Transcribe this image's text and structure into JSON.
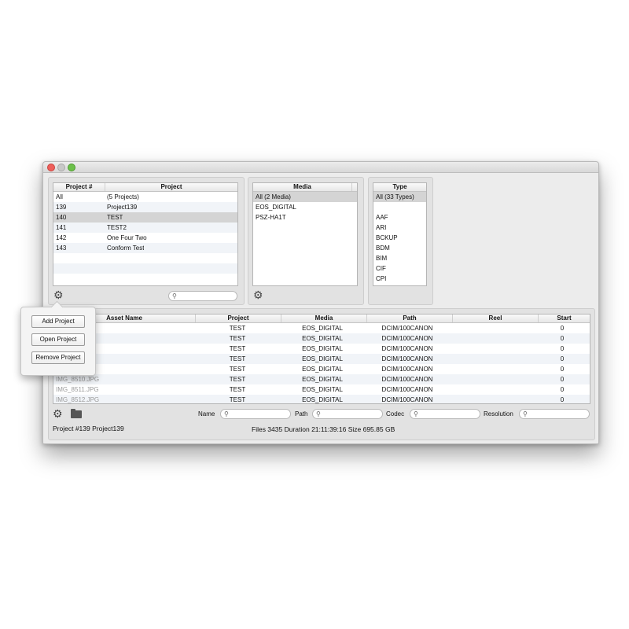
{
  "projects": {
    "headers": [
      "Project #",
      "Project"
    ],
    "rows": [
      [
        "All",
        "(5 Projects)"
      ],
      [
        "139",
        "Project139"
      ],
      [
        "140",
        "TEST"
      ],
      [
        "141",
        "TEST2"
      ],
      [
        "142",
        "One Four Two"
      ],
      [
        "143",
        "Conform Test"
      ]
    ]
  },
  "media": {
    "header": "Media",
    "rows": [
      "All (2 Media)",
      "EOS_DIGITAL",
      "PSZ-HA1T"
    ]
  },
  "type": {
    "header": "Type",
    "rows": [
      "All (33 Types)",
      "",
      "AAF",
      "ARI",
      "BCKUP",
      "BDM",
      "BIM",
      "CIF",
      "CPI"
    ]
  },
  "popover": {
    "add": "Add Project",
    "open": "Open Project",
    "remove": "Remove Project"
  },
  "assets": {
    "headers": [
      "Asset Name",
      "Project",
      "Media",
      "Path",
      "Reel",
      "Start"
    ],
    "rows": [
      [
        "",
        "TEST",
        "EOS_DIGITAL",
        "DCIM/100CANON",
        "",
        "0"
      ],
      [
        "",
        "TEST",
        "EOS_DIGITAL",
        "DCIM/100CANON",
        "",
        "0"
      ],
      [
        "",
        "TEST",
        "EOS_DIGITAL",
        "DCIM/100CANON",
        "",
        "0"
      ],
      [
        "",
        "TEST",
        "EOS_DIGITAL",
        "DCIM/100CANON",
        "",
        "0"
      ],
      [
        "",
        "TEST",
        "EOS_DIGITAL",
        "DCIM/100CANON",
        "",
        "0"
      ],
      [
        "IMG_8510.JPG",
        "TEST",
        "EOS_DIGITAL",
        "DCIM/100CANON",
        "",
        "0"
      ],
      [
        "IMG_8511.JPG",
        "TEST",
        "EOS_DIGITAL",
        "DCIM/100CANON",
        "",
        "0"
      ],
      [
        "IMG_8512.JPG",
        "TEST",
        "EOS_DIGITAL",
        "DCIM/100CANON",
        "",
        "0"
      ]
    ]
  },
  "filters": {
    "name_label": "Name",
    "path_label": "Path",
    "codec_label": "Codec",
    "resolution_label": "Resolution"
  },
  "status": {
    "project": "Project #139  Project139",
    "summary": "Files 3435 Duration 21:11:39:16 Size 695.85 GB"
  },
  "icons": {
    "gear": "gear-icon",
    "folder": "folder-icon",
    "search": "search-icon"
  }
}
